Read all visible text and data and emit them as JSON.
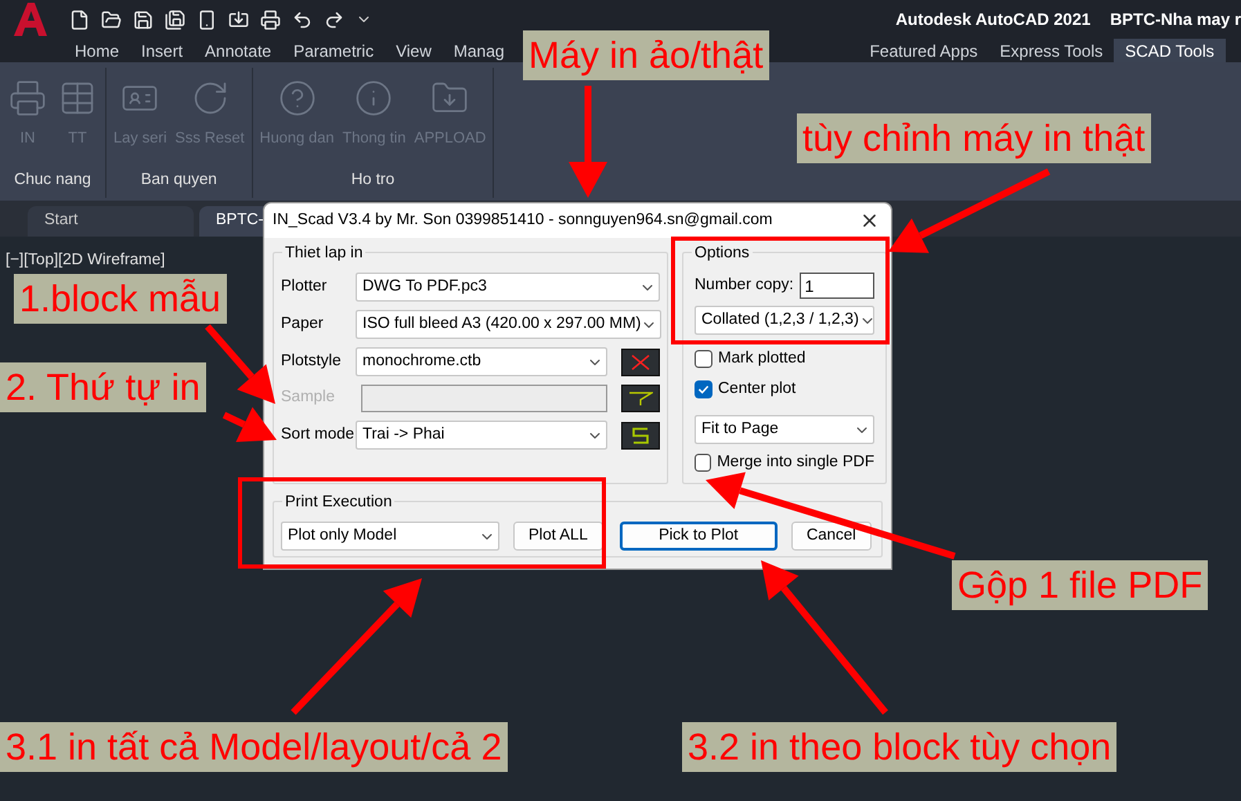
{
  "app": {
    "title": "Autodesk AutoCAD 2021",
    "document": "BPTC-Nha may r"
  },
  "ribbon_tabs": [
    {
      "label": "Home",
      "selected": false
    },
    {
      "label": "Insert",
      "selected": false
    },
    {
      "label": "Annotate",
      "selected": false
    },
    {
      "label": "Parametric",
      "selected": false
    },
    {
      "label": "View",
      "selected": false
    },
    {
      "label": "Manag",
      "selected": false
    },
    {
      "label": "Featured Apps",
      "selected": false
    },
    {
      "label": "Express Tools",
      "selected": false
    },
    {
      "label": "SCAD Tools",
      "selected": true
    }
  ],
  "ribbon_panels": [
    {
      "title": "Chuc nang",
      "tools": [
        {
          "label": "IN"
        },
        {
          "label": "TT"
        }
      ]
    },
    {
      "title": "Ban quyen",
      "tools": [
        {
          "label": "Lay seri"
        },
        {
          "label": "Sss Reset"
        }
      ]
    },
    {
      "title": "Ho tro",
      "tools": [
        {
          "label": "Huong dan"
        },
        {
          "label": "Thong tin"
        },
        {
          "label": "APPLOAD"
        }
      ]
    }
  ],
  "file_tabs": [
    {
      "label": "Start",
      "selected": false
    },
    {
      "label": "BPTC-",
      "selected": true
    }
  ],
  "viewport_label": "[−][Top][2D Wireframe]",
  "dialog": {
    "title": "IN_Scad V3.4 by Mr. Son 0399851410 - sonnguyen964.sn@gmail.com",
    "settings": {
      "title": "Thiet lap in",
      "rows": [
        {
          "label": "Plotter",
          "kind": "dropdown",
          "value": "DWG To PDF.pc3",
          "disabled": false,
          "has_button": false
        },
        {
          "label": "Paper",
          "kind": "dropdown",
          "value": "ISO full bleed A3 (420.00 x 297.00 MM)",
          "disabled": false,
          "has_button": false
        },
        {
          "label": "Plotstyle",
          "kind": "dropdown",
          "value": "monochrome.ctb",
          "disabled": false,
          "has_button": true
        },
        {
          "label": "Sample",
          "kind": "field",
          "value": "",
          "disabled": true,
          "has_button": true
        },
        {
          "label": "Sort mode",
          "kind": "dropdown",
          "value": "Trai -> Phai",
          "disabled": false,
          "has_button": true
        }
      ]
    },
    "options": {
      "title": "Options",
      "copies_label": "Number copy:",
      "copies": "1",
      "collate": "Collated (1,2,3 / 1,2,3)",
      "checks": [
        {
          "label": "Mark plotted",
          "checked": false
        },
        {
          "label": "Center plot",
          "checked": true
        }
      ],
      "fit": "Fit to Page",
      "merge": {
        "label": "Merge into single PDF",
        "checked": false
      }
    },
    "execution": {
      "title": "Print Execution",
      "mode": "Plot only Model",
      "plot_all": "Plot ALL"
    },
    "buttons": [
      {
        "label": "Pick to Plot",
        "default": true
      },
      {
        "label": "Cancel",
        "default": false
      }
    ]
  },
  "annotations": [
    {
      "text": "Máy in ảo/thật"
    },
    {
      "text": "tùy chỉnh máy in thật"
    },
    {
      "text": "1.block mẫu"
    },
    {
      "text": "2. Thứ tự in"
    },
    {
      "text": "Gộp 1 file PDF"
    },
    {
      "text": "3.1 in tất cả Model/layout/cả 2"
    },
    {
      "text": "3.2 in theo block tùy chọn"
    }
  ]
}
